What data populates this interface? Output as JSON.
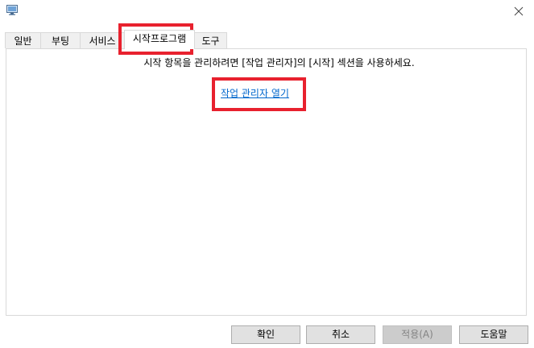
{
  "window": {
    "icon": "msconfig-icon",
    "close_glyph": "✕"
  },
  "tabs": [
    {
      "label": "일반",
      "active": false
    },
    {
      "label": "부팅",
      "active": false
    },
    {
      "label": "서비스",
      "active": false
    },
    {
      "label": "시작프로그램",
      "active": true
    },
    {
      "label": "도구",
      "active": false
    }
  ],
  "startup": {
    "description": "시작 항목을 관리하려면 [작업 관리자]의 [시작] 섹션을 사용하세요.",
    "open_task_manager_link": "작업 관리자 열기"
  },
  "buttons": {
    "ok": "확인",
    "cancel": "취소",
    "apply": "적용(A)",
    "help": "도움말"
  },
  "colors": {
    "highlight": "#e8212e",
    "link": "#0066cc"
  }
}
